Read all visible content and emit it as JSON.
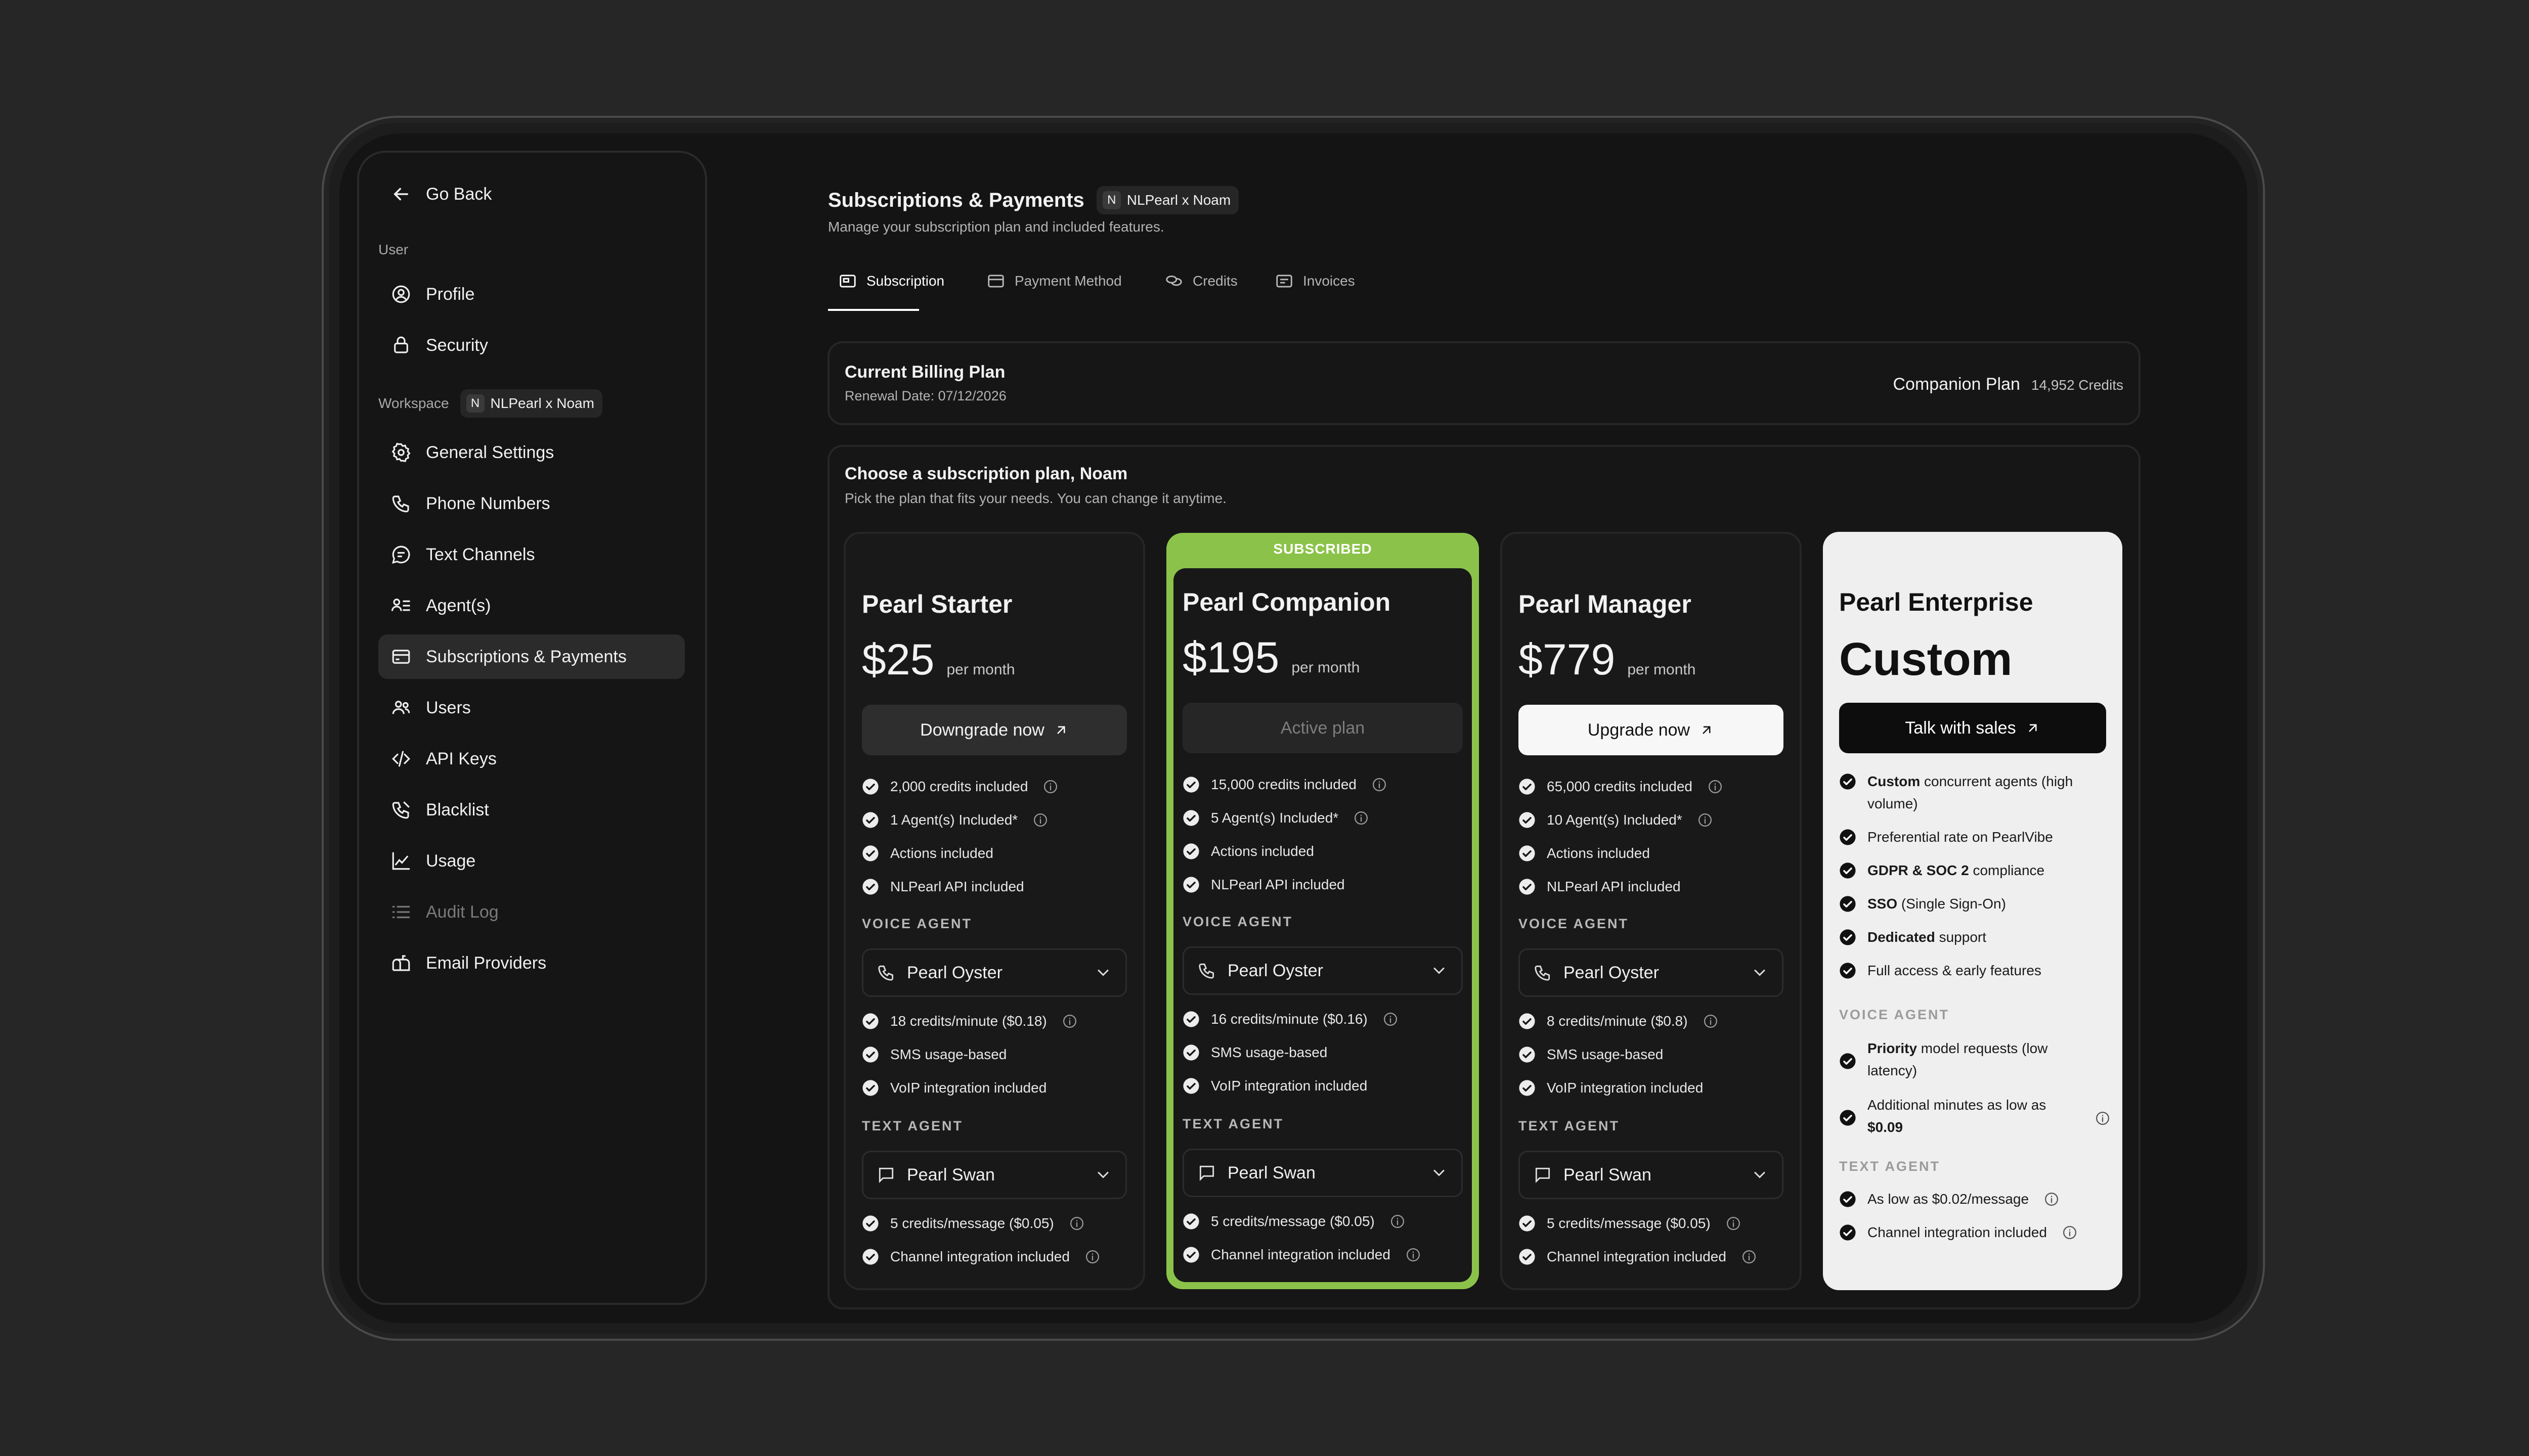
{
  "sidebar": {
    "go_back": "Go Back",
    "user_label": "User",
    "user_items": [
      "Profile",
      "Security"
    ],
    "workspace_label": "Workspace",
    "workspace_initial": "N",
    "workspace_name": "NLPearl x Noam",
    "items": [
      {
        "label": "General Settings",
        "icon": "gear-icon"
      },
      {
        "label": "Phone Numbers",
        "icon": "phone-icon"
      },
      {
        "label": "Text Channels",
        "icon": "chat-icon"
      },
      {
        "label": "Agent(s)",
        "icon": "agents-icon"
      },
      {
        "label": "Subscriptions & Payments",
        "icon": "card-icon",
        "active": true
      },
      {
        "label": "Users",
        "icon": "users-icon"
      },
      {
        "label": "API Keys",
        "icon": "code-icon"
      },
      {
        "label": "Blacklist",
        "icon": "phone-block-icon"
      },
      {
        "label": "Usage",
        "icon": "chart-icon"
      },
      {
        "label": "Audit Log",
        "icon": "list-icon",
        "muted": true
      },
      {
        "label": "Email Providers",
        "icon": "mailbox-icon"
      }
    ]
  },
  "header": {
    "title": "Subscriptions & Payments",
    "workspace_initial": "N",
    "workspace_name": "NLPearl x Noam",
    "subtitle": "Manage your subscription plan and included features."
  },
  "tabs": [
    "Subscription",
    "Payment Method",
    "Credits",
    "Invoices"
  ],
  "billing": {
    "title": "Current Billing Plan",
    "renewal": "Renewal Date: 07/12/2026",
    "plan": "Companion Plan",
    "credits": "14,952 Credits"
  },
  "choose": {
    "title": "Choose a subscription plan, Noam",
    "subtitle": "Pick the plan that fits your needs. You can change it anytime."
  },
  "plans": [
    {
      "name": "Pearl Starter",
      "price": "$25",
      "period": "per month",
      "button": "Downgrade now",
      "features": [
        "2,000 credits included",
        "1 Agent(s) Included*",
        "Actions included",
        "NLPearl API included"
      ],
      "voice_label": "VOICE AGENT",
      "voice_agent": "Pearl Oyster",
      "voice_features": [
        "18 credits/minute ($0.18)",
        "SMS usage-based",
        "VoIP integration included"
      ],
      "text_label": "TEXT AGENT",
      "text_agent": "Pearl Swan",
      "text_features": [
        "5 credits/message ($0.05)",
        "Channel integration included"
      ]
    },
    {
      "name": "Pearl Companion",
      "price": "$195",
      "period": "per month",
      "button": "Active plan",
      "badge": "SUBSCRIBED",
      "features": [
        "15,000 credits included",
        "5 Agent(s) Included*",
        "Actions included",
        "NLPearl API included"
      ],
      "voice_label": "VOICE AGENT",
      "voice_agent": "Pearl Oyster",
      "voice_features": [
        "16 credits/minute ($0.16)",
        "SMS usage-based",
        "VoIP integration included"
      ],
      "text_label": "TEXT AGENT",
      "text_agent": "Pearl Swan",
      "text_features": [
        "5 credits/message ($0.05)",
        "Channel integration included"
      ]
    },
    {
      "name": "Pearl Manager",
      "price": "$779",
      "period": "per month",
      "button": "Upgrade now",
      "features": [
        "65,000 credits included",
        "10 Agent(s) Included*",
        "Actions included",
        "NLPearl API included"
      ],
      "voice_label": "VOICE AGENT",
      "voice_agent": "Pearl Oyster",
      "voice_features": [
        "8 credits/minute ($0.8)",
        "SMS usage-based",
        "VoIP integration included"
      ],
      "text_label": "TEXT AGENT",
      "text_agent": "Pearl Swan",
      "text_features": [
        "5 credits/message ($0.05)",
        "Channel integration included"
      ]
    },
    {
      "name": "Pearl Enterprise",
      "price": "Custom",
      "button": "Talk with sales",
      "features": [
        {
          "bold": "Custom",
          "text": " concurrent agents (high volume)"
        },
        {
          "bold": "",
          "text": "Preferential rate on PearlVibe"
        },
        {
          "bold": "GDPR & SOC 2",
          "text": " compliance"
        },
        {
          "bold": "SSO",
          "text": " (Single Sign-On)"
        },
        {
          "bold": "Dedicated",
          "text": " support"
        },
        {
          "bold": "",
          "text": "Full access & early features"
        }
      ],
      "voice_label": "VOICE AGENT",
      "voice_features": [
        {
          "bold": "Priority",
          "text": " model requests (low latency)"
        },
        {
          "text": "Additional minutes as low as ",
          "bold_end": "$0.09"
        }
      ],
      "text_label": "TEXT AGENT",
      "text_features": [
        "As low as $0.02/message",
        "Channel integration included"
      ]
    }
  ],
  "colors": {
    "accent_green": "#8bc34a",
    "background": "#141414"
  }
}
